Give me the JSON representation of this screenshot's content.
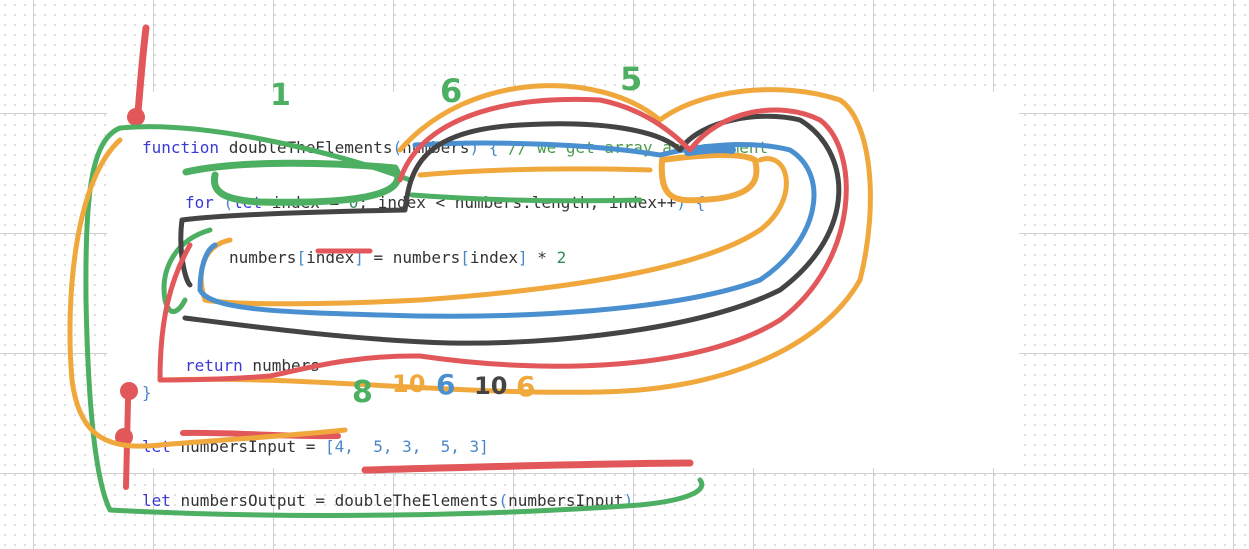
{
  "colors": {
    "keyword": "#3a3ad6",
    "comment": "#4a9a4a",
    "number": "#2e8b57",
    "bracket": "#4a86c8",
    "ink_red": "#e2585a",
    "ink_green": "#4caf62",
    "ink_orange": "#f0a83c",
    "ink_blue": "#4a90d0",
    "ink_black": "#444444"
  },
  "code": {
    "l1": {
      "kw": "function",
      "name": " doubleTheElements",
      "open": "(",
      "param": "numbers",
      "close": ")",
      "brace": " {",
      "comment": " // we get array as argument"
    },
    "l2": {
      "kw": "for",
      "open": " (",
      "let": "let",
      "init": " index = ",
      "zero": "0",
      "semi1": "; ",
      "cond": "index < numbers.length; ",
      "inc": "index++",
      "close": ")",
      "brace": " {"
    },
    "l3": {
      "a": "numbers",
      "b1": "[",
      "idx": "index",
      "b2": "]",
      "mid": " = numbers",
      "b3": "[",
      "idx2": "index",
      "b4": "]",
      "op": " * ",
      "two": "2"
    },
    "l4": {
      "kw": "return",
      "rest": " numbers"
    },
    "l5": {
      "brace": "}"
    },
    "l6": {
      "kw": "let",
      "rest": " numbersInput = ",
      "arr": "[4,  5, 3,  5, 3]"
    },
    "l7": {
      "kw": "let",
      "rest": " numbersOutput = doubleTheElements",
      "open": "(",
      "arg": "numbersInput",
      "close": ")"
    }
  },
  "annotations": {
    "green_1": "1",
    "green_6": "6",
    "green_5": "5",
    "green_8": "8",
    "orange_10": "10",
    "blue_6": "6",
    "black_10": "10",
    "orange_6": "6"
  }
}
